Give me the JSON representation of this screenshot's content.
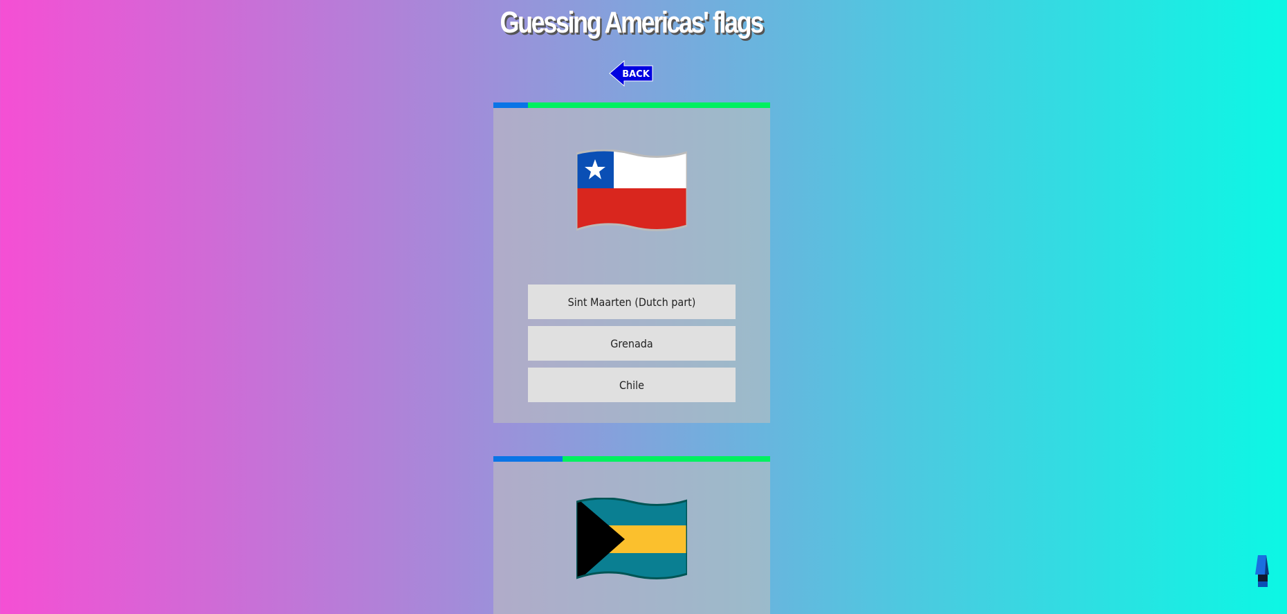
{
  "header": {
    "title": "Guessing Americas' flags",
    "back_label": "BACK"
  },
  "questions": [
    {
      "flag": "Chile",
      "timer_fraction": 0.125,
      "options": [
        "Sint Maarten (Dutch part)",
        "Grenada",
        "Chile"
      ]
    },
    {
      "flag": "Bahamas",
      "timer_fraction": 0.25,
      "options": []
    }
  ],
  "colors": {
    "timer_elapsed": "#0a74e6",
    "timer_remaining": "#00f060",
    "back_button": "#0000e0"
  },
  "scroll_top_icon": "up-arrow-icon"
}
